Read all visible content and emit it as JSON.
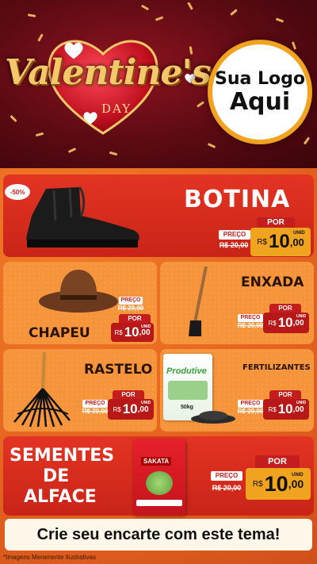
{
  "header": {
    "title_script": "Valentine's",
    "title_day": "DAY",
    "logo_line1": "Sua Logo",
    "logo_line2": "Aqui"
  },
  "products": {
    "botina": {
      "name": "BOTINA",
      "badge": "-50%",
      "preco": "PREÇO",
      "old": "R$ 20,00",
      "por": "POR",
      "rs": "R$",
      "price_int": "10",
      "price_cents": ",00",
      "unit": "UNID"
    },
    "chapeu": {
      "name": "CHAPEU",
      "preco": "PREÇO",
      "old": "R$ 20,00",
      "por": "POR",
      "rs": "R$",
      "price_int": "10",
      "price_cents": ",00",
      "unit": "UNID"
    },
    "enxada": {
      "name": "ENXADA",
      "preco": "PREÇO",
      "old": "R$ 20,00",
      "por": "POR",
      "rs": "R$",
      "price_int": "10",
      "price_cents": ",00",
      "unit": "UNID"
    },
    "rastelo": {
      "name": "RASTELO",
      "preco": "PREÇO",
      "old": "R$ 20,00",
      "por": "POR",
      "rs": "R$",
      "price_int": "10",
      "price_cents": ",00",
      "unit": "UNID"
    },
    "fertilizantes": {
      "name": "FERTILIZANTES",
      "bag_brand": "Produtive",
      "bag_weight": "50kg",
      "preco": "PREÇO",
      "old": "R$ 20,00",
      "por": "POR",
      "rs": "R$",
      "price_int": "10",
      "price_cents": ",00",
      "unit": "UNID"
    },
    "sementes": {
      "name_l1": "SEMENTES",
      "name_l2": "DE",
      "name_l3": "ALFACE",
      "pack_brand": "SAKATA",
      "preco": "PREÇO",
      "old": "R$ 20,00",
      "por": "POR",
      "rs": "R$",
      "price_int": "10",
      "price_cents": ",00",
      "unit": "UNID"
    }
  },
  "footer": {
    "cta": "Crie seu encarte com este tema!",
    "disclaimer": "*Imagens Meramente Ilustrativas"
  },
  "colors": {
    "red": "#c41d1d",
    "orange": "#f5943a",
    "gold": "#f3c76a"
  }
}
